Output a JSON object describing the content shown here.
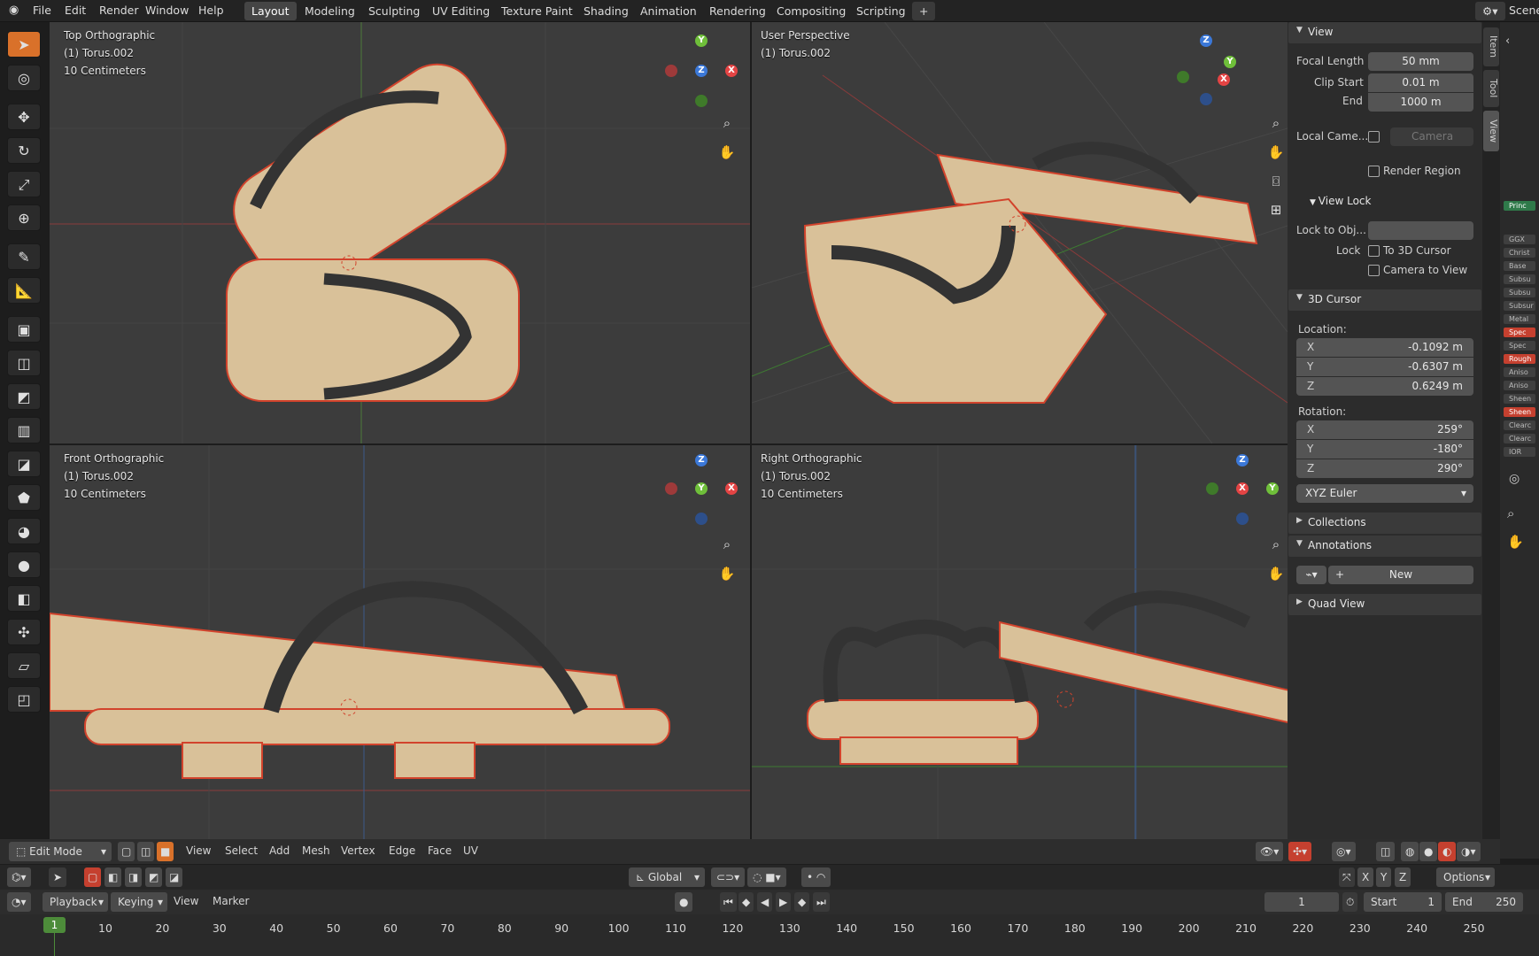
{
  "topbar": {
    "menus": [
      "File",
      "Edit",
      "Render",
      "Window",
      "Help"
    ],
    "workspaces": [
      "Layout",
      "Modeling",
      "Sculpting",
      "UV Editing",
      "Texture Paint",
      "Shading",
      "Animation",
      "Rendering",
      "Compositing",
      "Scripting"
    ],
    "active_workspace": "Layout",
    "add_tab": "+",
    "scene_label": "Scene"
  },
  "viewports": {
    "top_left": {
      "title": "Top Orthographic",
      "object": "(1) Torus.002",
      "scale": "10 Centimeters"
    },
    "top_right": {
      "title": "User Perspective",
      "object": "(1) Torus.002"
    },
    "bottom_left": {
      "title": "Front Orthographic",
      "object": "(1) Torus.002",
      "scale": "10 Centimeters"
    },
    "bottom_right": {
      "title": "Right Orthographic",
      "object": "(1) Torus.002",
      "scale": "10 Centimeters"
    }
  },
  "gizmo": {
    "x": "X",
    "y": "Y",
    "z": "Z"
  },
  "npanel": {
    "view_header": "View",
    "focal_length_label": "Focal Length",
    "focal_length": "50 mm",
    "clip_start_label": "Clip Start",
    "clip_start": "0.01 m",
    "end_label": "End",
    "clip_end": "1000 m",
    "local_camera_label": "Local Came...",
    "camera_placeholder": "Camera",
    "render_region_label": "Render Region",
    "view_lock_header": "View Lock",
    "lock_to_obj_label": "Lock to Obj...",
    "lock_label": "Lock",
    "to_3d_cursor_label": "To 3D Cursor",
    "camera_to_view_label": "Camera to View",
    "cursor_header": "3D Cursor",
    "location_label": "Location:",
    "location": [
      {
        "axis": "X",
        "value": "-0.1092 m"
      },
      {
        "axis": "Y",
        "value": "-0.6307 m"
      },
      {
        "axis": "Z",
        "value": "0.6249 m"
      }
    ],
    "rotation_label": "Rotation:",
    "rotation": [
      {
        "axis": "X",
        "value": "259°"
      },
      {
        "axis": "Y",
        "value": "-180°"
      },
      {
        "axis": "Z",
        "value": "290°"
      }
    ],
    "rotation_mode": "XYZ Euler",
    "collections_header": "Collections",
    "annotations_header": "Annotations",
    "new_button": "New",
    "quad_view_header": "Quad View"
  },
  "side_tabs": [
    "Item",
    "Tool",
    "View"
  ],
  "far_strip": [
    "Princ",
    "GGX",
    "Christ",
    "Base Co",
    "Subsu",
    "Subsu",
    "Subsur",
    "Metal",
    "Spec",
    "Spec",
    "Rough",
    "Aniso",
    "Aniso",
    "Sheen",
    "Sheen",
    "Clearc",
    "Clearc",
    "IOR"
  ],
  "viewport_header": {
    "mode": "Edit Mode",
    "menus": [
      "View",
      "Select",
      "Add",
      "Mesh",
      "Vertex",
      "Edge",
      "Face",
      "UV"
    ]
  },
  "tool_header": {
    "orientation": "Global",
    "axes": [
      "X",
      "Y",
      "Z"
    ],
    "options": "Options"
  },
  "timeline_header": {
    "menus": [
      "Playback",
      "Keying",
      "View",
      "Marker"
    ],
    "current_frame": "1",
    "start_label": "Start",
    "start": "1",
    "end_label": "End",
    "end": "250"
  },
  "timeline": {
    "current": "1",
    "ticks": [
      "10",
      "20",
      "30",
      "40",
      "50",
      "60",
      "70",
      "80",
      "90",
      "100",
      "110",
      "120",
      "130",
      "140",
      "150",
      "160",
      "170",
      "180",
      "190",
      "200",
      "210",
      "220",
      "230",
      "240",
      "250"
    ]
  },
  "colors": {
    "accent": "#4f79b4",
    "selected_edge": "#e0412b",
    "wood": "#d9c199",
    "strap": "#3b3b3b"
  }
}
